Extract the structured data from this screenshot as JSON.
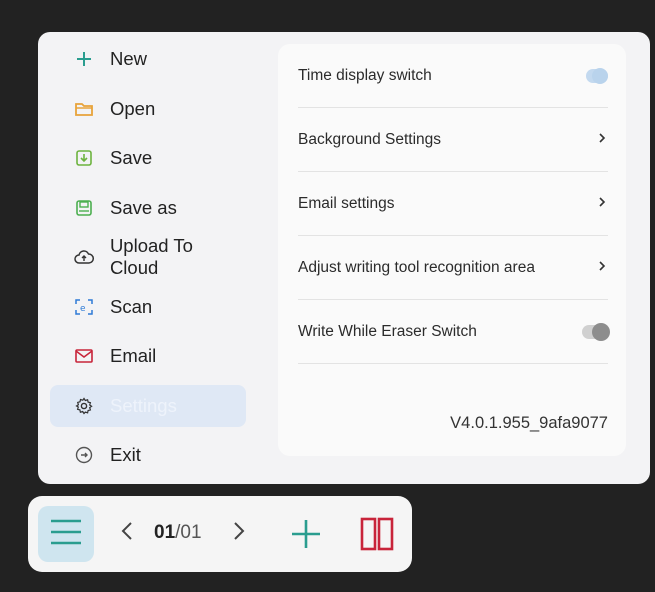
{
  "menu": {
    "items": [
      {
        "label": "New",
        "icon": "plus-icon"
      },
      {
        "label": "Open",
        "icon": "folder-icon"
      },
      {
        "label": "Save",
        "icon": "save-icon"
      },
      {
        "label": "Save as",
        "icon": "save-as-icon"
      },
      {
        "label": "Upload To Cloud",
        "icon": "cloud-upload-icon"
      },
      {
        "label": "Scan",
        "icon": "scan-icon"
      },
      {
        "label": "Email",
        "icon": "mail-icon"
      },
      {
        "label": "Settings",
        "icon": "gear-icon",
        "active": true
      },
      {
        "label": "Exit",
        "icon": "exit-icon"
      }
    ]
  },
  "settings": {
    "time_display": {
      "label": "Time display switch",
      "state": "on"
    },
    "background": {
      "label": "Background Settings"
    },
    "email": {
      "label": "Email settings"
    },
    "recognition": {
      "label": "Adjust writing tool recognition area"
    },
    "write_eraser": {
      "label": "Write While Eraser Switch",
      "state": "off"
    },
    "version": "V4.0.1.955_9afa9077"
  },
  "toolbar": {
    "current_page": "01",
    "page_separator": "/",
    "total_pages": "01"
  },
  "colors": {
    "accent_teal": "#2a9d8f",
    "accent_red": "#c8243a",
    "active_bg": "#dfe8f5"
  }
}
